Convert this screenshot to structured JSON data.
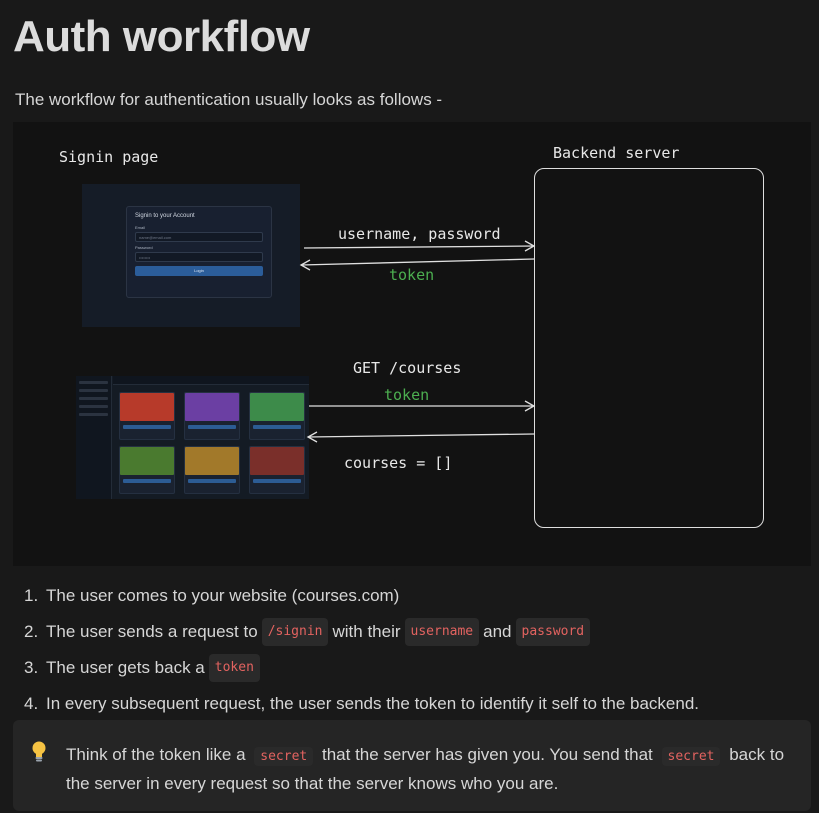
{
  "page": {
    "title": "Auth workflow",
    "intro": "The workflow for authentication usually looks as follows -"
  },
  "diagram": {
    "signin_label": "Signin page",
    "server_label": "Backend server",
    "arrow1_label": "username, password",
    "arrow2_label": "token",
    "arrow3_label": "GET /courses",
    "arrow3_sublabel": "token",
    "arrow4_label": "courses = []",
    "signin_card": {
      "title": "Signin to your Account",
      "email_label": "Email",
      "email_placeholder": "name@email.com",
      "password_label": "Password",
      "password_value": "••••••••",
      "button_label": "Login"
    }
  },
  "steps": [
    {
      "num": "1.",
      "text_before": "The user comes to your website (courses.com)"
    },
    {
      "num": "2.",
      "text_before": "The user sends a request to",
      "code1": "/signin",
      "text_mid": "with their",
      "code2": "username",
      "text_mid2": "and",
      "code3": "password"
    },
    {
      "num": "3.",
      "text_before": "The user gets back a",
      "code1": "token"
    },
    {
      "num": "4.",
      "text_before": "In every subsequent request, the user sends the token to identify it self to the backend."
    }
  ],
  "callout": {
    "icon": "lightbulb-icon",
    "text_before": "Think of the token like a",
    "code1": "secret",
    "text_mid": "that the server has given you. You send that",
    "code2": "secret",
    "text_after": "back to the server in every request so that the server knows who you are."
  },
  "colors": {
    "background": "#191919",
    "code_text": "#e36360",
    "token_green": "#4caf50"
  }
}
